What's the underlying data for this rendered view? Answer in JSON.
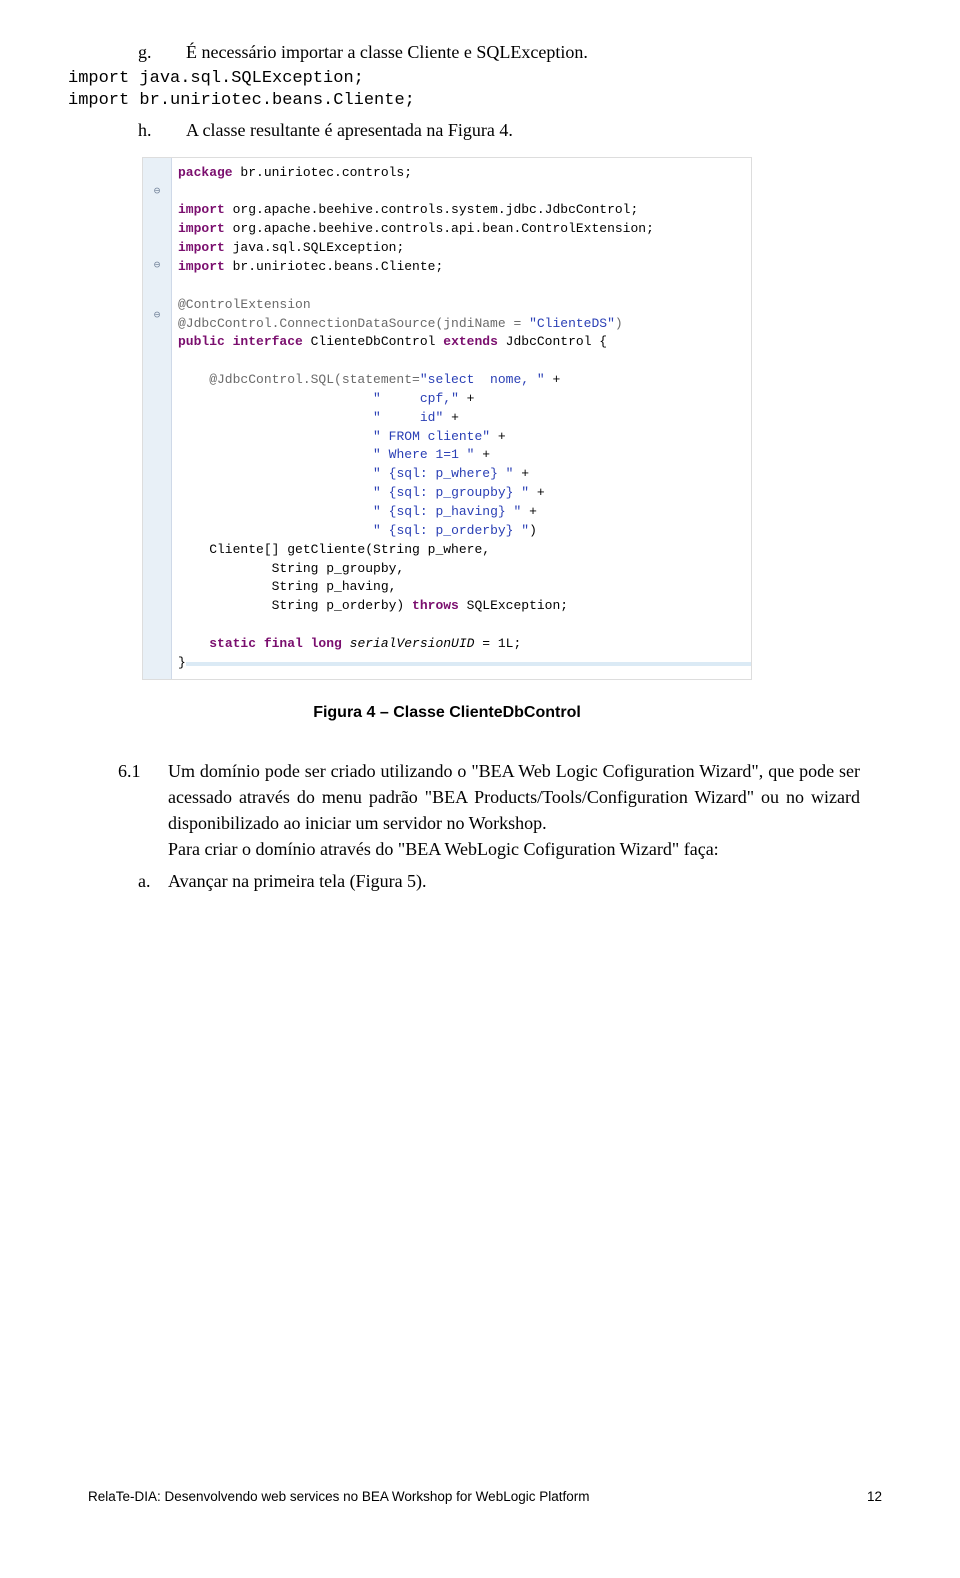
{
  "items": {
    "g_marker": "g.",
    "g_text": "É necessário importar a classe Cliente e SQLException.",
    "import1": "import java.sql.SQLException;",
    "import2": "import br.uniriotec.beans.Cliente;",
    "h_marker": "h.",
    "h_text": "A classe resultante é apresentada na Figura 4."
  },
  "code": {
    "l1_kw": "package",
    "l1_rest": " br.uniriotec.controls;",
    "l2_kw": "import",
    "l2_rest": " org.apache.beehive.controls.system.jdbc.JdbcControl;",
    "l3_kw": "import",
    "l3_rest": " org.apache.beehive.controls.api.bean.ControlExtension;",
    "l4_kw": "import",
    "l4_rest": " java.sql.SQLException;",
    "l5_kw": "import",
    "l5_rest": " br.uniriotec.beans.Cliente;",
    "ann1": "@ControlExtension",
    "ann2a": "@JdbcControl.ConnectionDataSource(jndiName = ",
    "ann2b": "\"ClienteDS\"",
    "ann2c": ")",
    "pub_kw": "public interface",
    "pub_mid": " ClienteDbControl ",
    "ext_kw": "extends",
    "pub_end": " JdbcControl {",
    "sql_head": "    @JdbcControl.SQL(statement=",
    "s1": "\"select  nome, \"",
    "plus": " +",
    "q": "\"",
    "s2": "     cpf,\"",
    "s3": "     id\"",
    "s4": " FROM cliente\"",
    "s5": " Where 1=1 \"",
    "s6": " {sql: p_where} \"",
    "s7": " {sql: p_groupby} \"",
    "s8": " {sql: p_having} \"",
    "s9": " {sql: p_orderby} \"",
    "sql_close": ")",
    "m1": "    Cliente[] getCliente(String p_where,",
    "m2": "            String p_groupby,",
    "m3": "            String p_having,",
    "m4a": "            String p_orderby) ",
    "m4_kw": "throws",
    "m4b": " SQLException;",
    "sf_kw": "static final long",
    "sf_mid": " serialVersionUID",
    "sf_end": " = 1L;",
    "brace": "}"
  },
  "caption": "Figura 4 – Classe ClienteDbControl",
  "section": {
    "num": "6.1",
    "para": "Um domínio pode ser criado utilizando o \"BEA Web Logic Cofiguration Wizard\", que pode ser acessado através do menu padrão \"BEA Products/Tools/Configuration Wizard\" ou no wizard disponibilizado ao iniciar um servidor no Workshop.",
    "para2": "Para criar o domínio através do \"BEA WebLogic Cofiguration Wizard\" faça:",
    "a_marker": "a.",
    "a_text": "Avançar na primeira tela (Figura 5)."
  },
  "footer": {
    "left": "RelaTe-DIA: Desenvolvendo web services no BEA Workshop for WebLogic Platform",
    "right": "12"
  }
}
